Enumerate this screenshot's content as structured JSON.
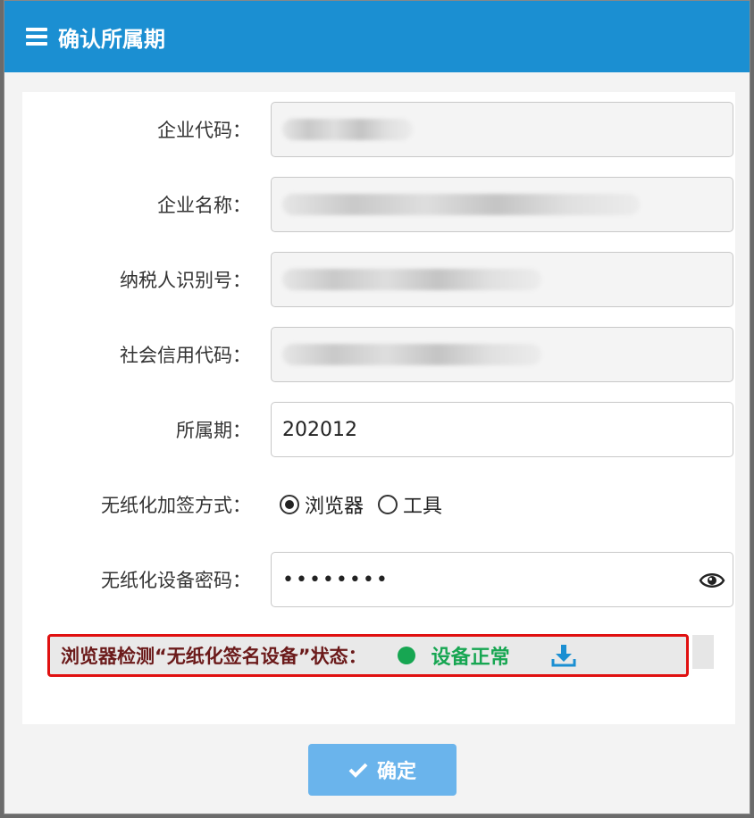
{
  "dialog": {
    "title": "确认所属期"
  },
  "form": {
    "company_code": {
      "label": "企业代码：",
      "value": ""
    },
    "company_name": {
      "label": "企业名称：",
      "value": ""
    },
    "taxpayer_id": {
      "label": "纳税人识别号：",
      "value": ""
    },
    "social_credit_code": {
      "label": "社会信用代码：",
      "value": ""
    },
    "period": {
      "label": "所属期：",
      "value": "202012"
    },
    "signing_method": {
      "label": "无纸化加签方式：",
      "options": [
        "浏览器",
        "工具"
      ],
      "selected": "浏览器"
    },
    "device_password": {
      "label": "无纸化设备密码：",
      "value": "••••••••"
    }
  },
  "status": {
    "label": "浏览器检测“无纸化签名设备”状态：",
    "text": "设备正常",
    "color": "#17a652"
  },
  "confirm_button": {
    "label": "确定"
  },
  "colors": {
    "titlebar": "#1b8fd2",
    "button": "#6ab4ec",
    "highlight_border": "#e01010"
  }
}
